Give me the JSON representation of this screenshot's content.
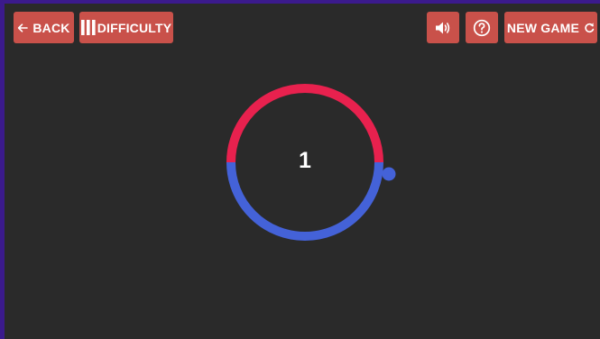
{
  "toolbar": {
    "back_label": "BACK",
    "back_icon": "arrow-left-icon",
    "difficulty_label": "DIFFICULTY",
    "difficulty_icon": "bars-icon",
    "sound_icon": "speaker-icon",
    "help_icon": "question-circle-icon",
    "new_game_label": "NEW GAME",
    "new_game_icon": "refresh-icon"
  },
  "game": {
    "score": "1",
    "ring_colors": {
      "top": "#e8214e",
      "bottom": "#4462d8"
    },
    "ball_color": "#4462d8"
  },
  "colors": {
    "button": "#c9514a",
    "background": "#2a2a2a",
    "frame_border": "#3b1a8c"
  }
}
